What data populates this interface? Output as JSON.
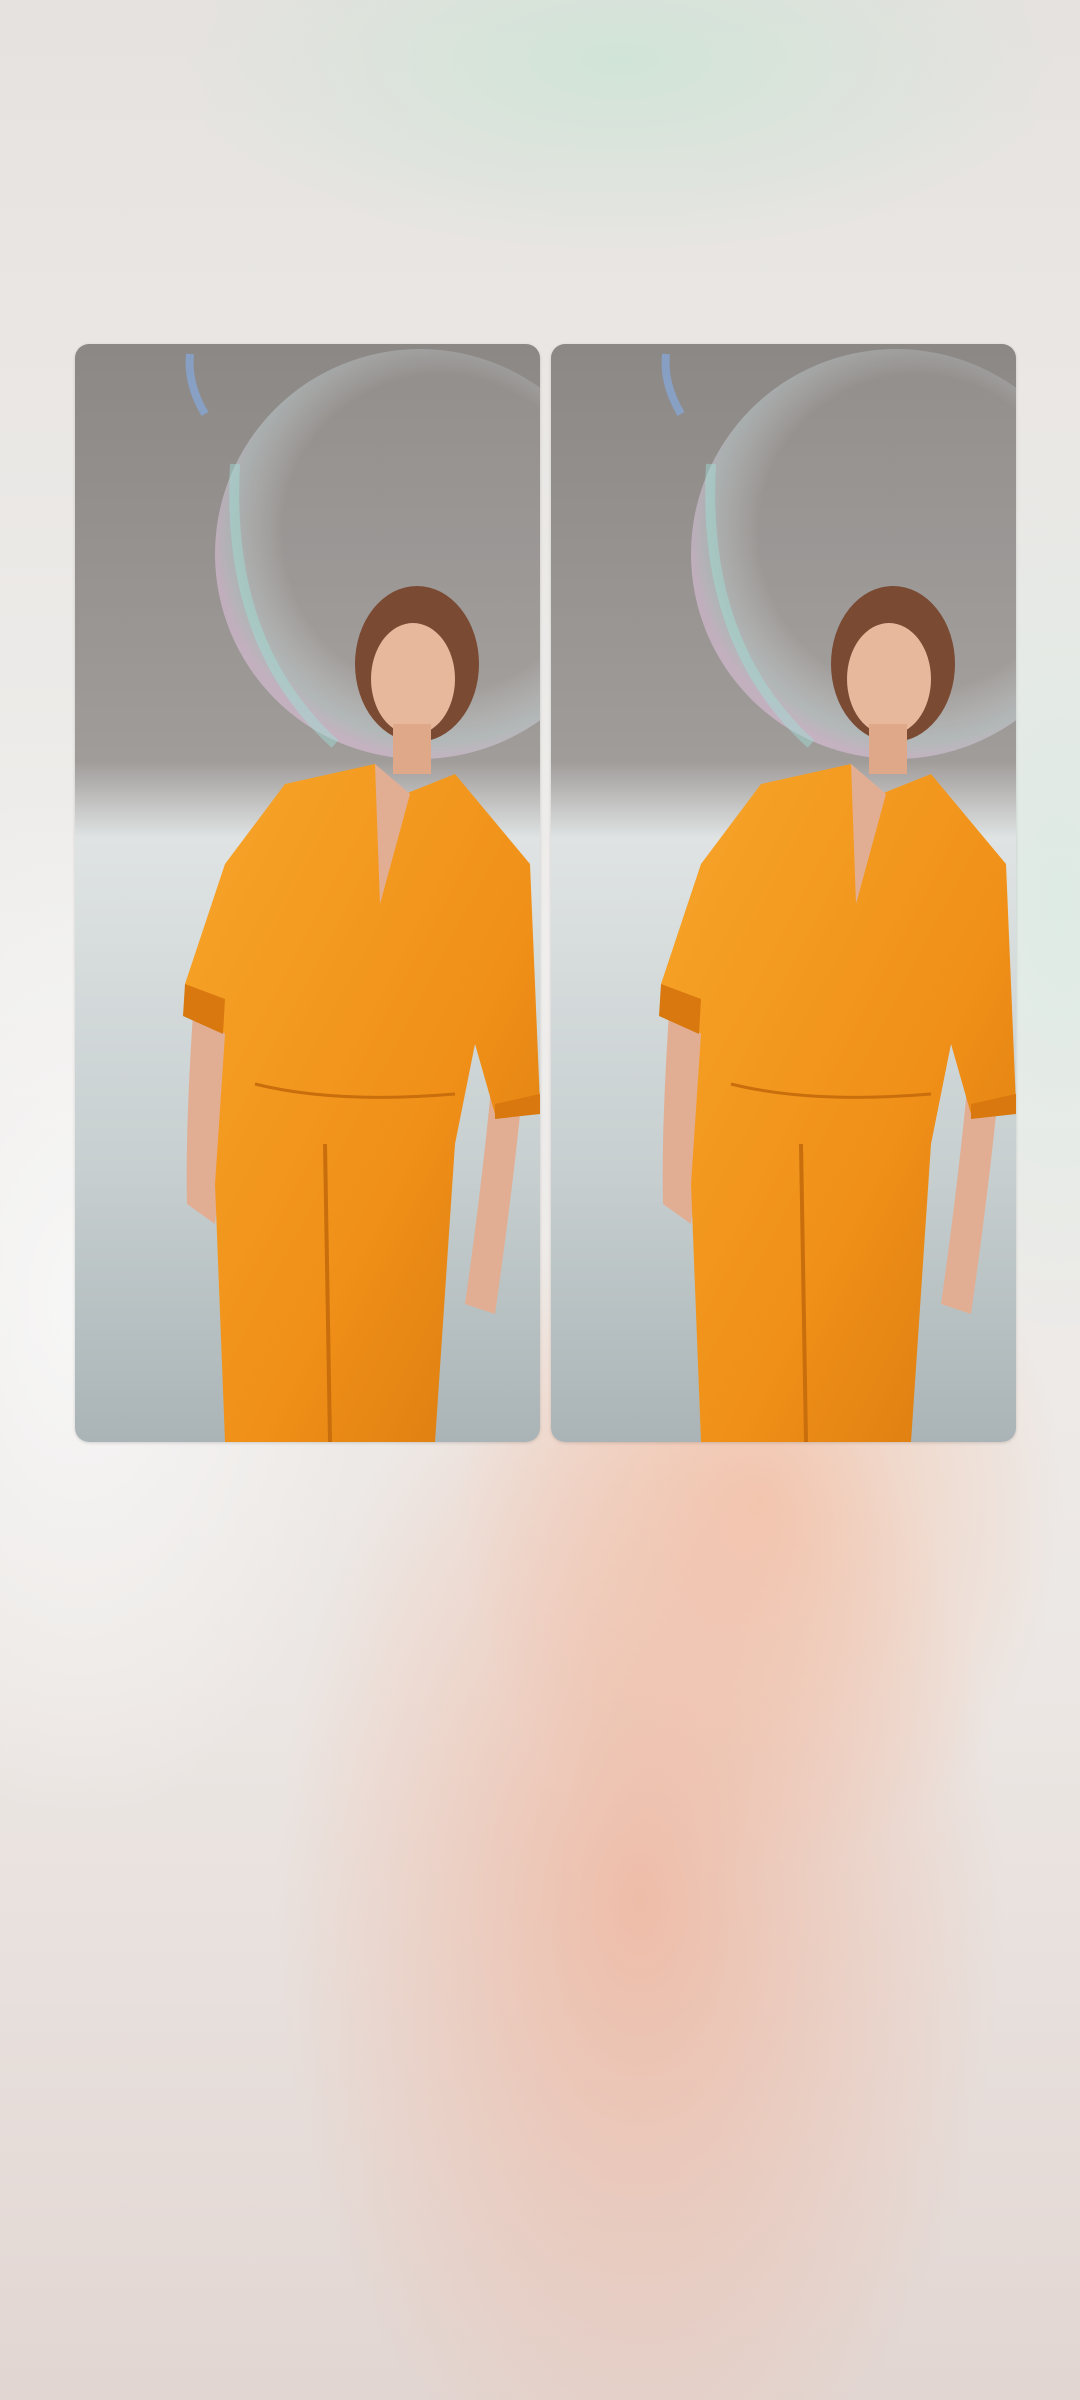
{
  "colors": {
    "wall_top": "#8e8a88",
    "wall_bottom": "#b9c2c3",
    "jumpsuit": "#f29a1e",
    "jumpsuit_shadow": "#d97a10",
    "skin": "#e6b49a",
    "hair": "#7a4a33",
    "bubble_tint": "#cfe9ee"
  },
  "preview": {
    "tiles": [
      {
        "id": "left",
        "description_icon": "photo-person-orange-jumpsuit-bubble"
      },
      {
        "id": "right",
        "description_icon": "photo-person-orange-jumpsuit-bubble"
      }
    ]
  }
}
